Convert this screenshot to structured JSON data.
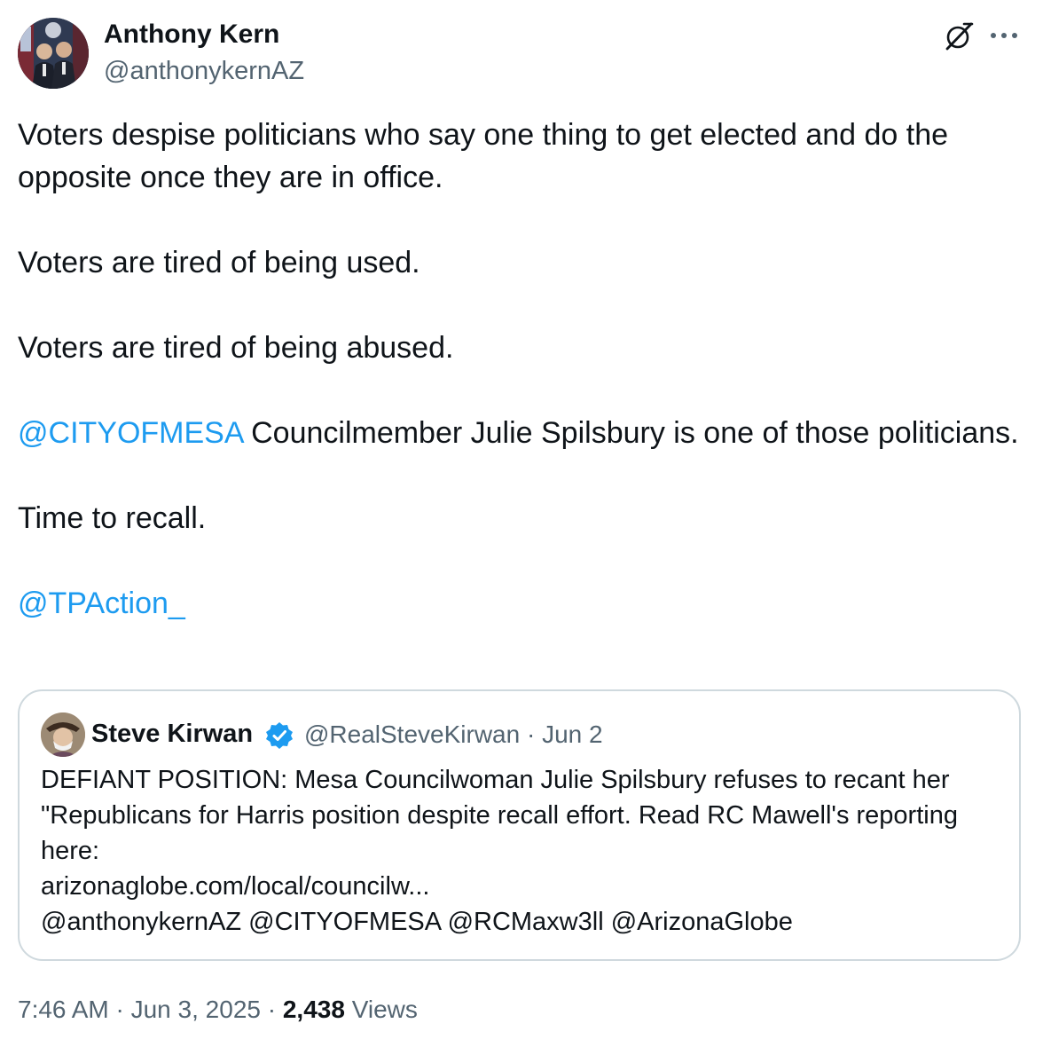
{
  "author": {
    "name": "Anthony Kern",
    "handle": "@anthonykernAZ"
  },
  "tweet": {
    "line1": "Voters despise politicians who say one thing to get elected and do the opposite once they are in office.",
    "line2": "Voters are tired of being used.",
    "line3": "Voters are tired of being abused.",
    "line4_mention": "@CITYOFMESA",
    "line4_rest": " Councilmember Julie Spilsbury is one of those politicians.",
    "line5": "Time to recall.",
    "line6_mention": "@TPAction_"
  },
  "quote": {
    "name": "Steve Kirwan",
    "handle_date": "@RealSteveKirwan · Jun 2",
    "text_main": "DEFIANT POSITION: Mesa Councilwoman Julie Spilsbury refuses to recant her \"Republicans for Harris position despite recall effort. Read RC Mawell's reporting here:",
    "link": "arizonaglobe.com/local/councilw...",
    "mentions": "@anthonykernAZ @CITYOFMESA @RCMaxw3ll @ArizonaGlobe"
  },
  "footer": {
    "time_date": "7:46 AM · Jun 3, 2025 · ",
    "views_count": "2,438",
    "views_label": " Views"
  },
  "icons": {
    "grok": "grok-icon",
    "more": "more-icon",
    "verified": "verified-badge-icon"
  },
  "colors": {
    "link": "#1d9bf0",
    "text": "#0f1419",
    "secondary": "#536471",
    "border": "#cfd9de"
  }
}
